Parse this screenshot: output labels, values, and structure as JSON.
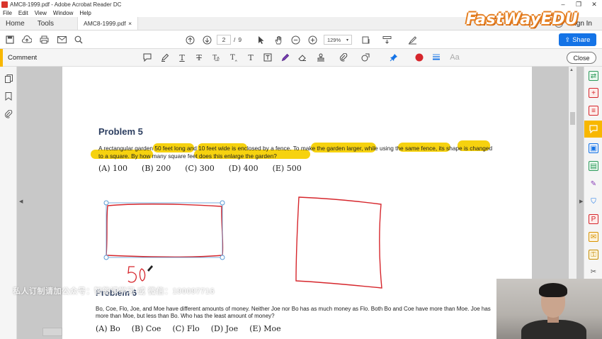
{
  "window": {
    "title": "AMC8-1999.pdf - Adobe Acrobat Reader DC",
    "menu": [
      "File",
      "Edit",
      "View",
      "Window",
      "Help"
    ],
    "controls": [
      "–",
      "❐",
      "✕"
    ]
  },
  "tabs": {
    "home": "Home",
    "tools": "Tools",
    "document": "AMC8-1999.pdf",
    "close_glyph": "×",
    "sign_in": "Sign In",
    "help_glyph": "?"
  },
  "brand": {
    "logo_text": "FastWayEDU"
  },
  "toolbar": {
    "page_current": "2",
    "page_separator": "/",
    "page_total": "9",
    "zoom": "129%",
    "share_label": "Share"
  },
  "comment_bar": {
    "label": "Comment",
    "close_label": "Close",
    "font_glyph": "Aa"
  },
  "document": {
    "problem5": {
      "title": "Problem 5",
      "text": "A rectangular garden 50 feet long and 10 feet wide is enclosed by a fence. To make the garden larger, while using the same fence, its shape is changed to a square. By how many square feet does this enlarge the garden?",
      "choices": [
        "(A) 100",
        "(B) 200",
        "(C) 300",
        "(D) 400",
        "(E) 500"
      ]
    },
    "problem6": {
      "title": "Problem 6",
      "text": "Bo, Coe, Flo, Joe, and Moe have different amounts of money. Neither Joe nor Bo has as much money as Flo. Both Bo and Coe have more than Moe. Joe has more than Moe, but less than Bo. Who has the least amount of money?",
      "choices": [
        "(A) Bo",
        "(B) Coe",
        "(C) Flo",
        "(D) Joe",
        "(E) Moe"
      ]
    },
    "handwritten_label": "50"
  },
  "overlay": {
    "watermark": "私人订制请加公众号：智能课学习 或 微信：190097716"
  },
  "colors": {
    "accent": "#f8b700",
    "share": "#1473e6",
    "highlight": "#f6d20f",
    "ink": "#d6262c",
    "heading": "#2c3e60"
  }
}
